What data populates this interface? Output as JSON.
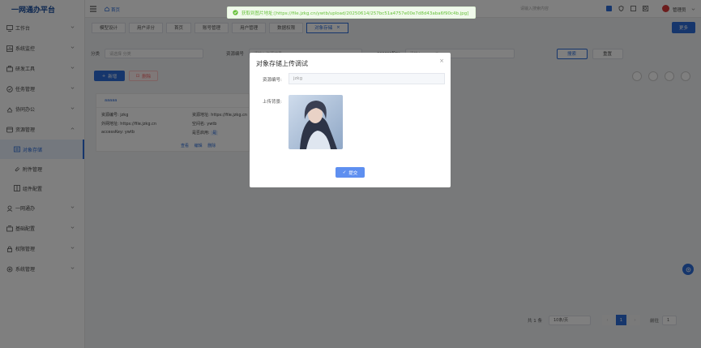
{
  "app": {
    "title": "一网通办平台"
  },
  "sidebar": {
    "items": [
      {
        "label": "工作台",
        "icon": "monitor-icon"
      },
      {
        "label": "系统监控",
        "icon": "chart-icon"
      },
      {
        "label": "研发工具",
        "icon": "tool-icon"
      },
      {
        "label": "任务管理",
        "icon": "task-icon"
      },
      {
        "label": "协同办公",
        "icon": "cowork-icon"
      },
      {
        "label": "资源管理",
        "icon": "resource-icon"
      }
    ],
    "sub_items": [
      {
        "label": "对象存储",
        "icon": "storage-icon"
      },
      {
        "label": "附件管理",
        "icon": "attachment-icon"
      },
      {
        "label": "组件配置",
        "icon": "config-icon"
      }
    ],
    "more_items": [
      {
        "label": "一网通办",
        "icon": "service-icon"
      },
      {
        "label": "基础配置",
        "icon": "base-icon"
      },
      {
        "label": "权限管理",
        "icon": "permission-icon"
      },
      {
        "label": "系统管理",
        "icon": "system-icon"
      }
    ]
  },
  "topbar": {
    "home": "首页",
    "search_placeholder": "请输入搜索内容",
    "username": "管理员"
  },
  "tabs": [
    "模型设计",
    "用户评分",
    "首页",
    "账号管理",
    "用户管理",
    "数据权限",
    "对象存储"
  ],
  "more_button": "更多",
  "filter": {
    "type_label": "分类",
    "type_placeholder": "请选择 分类",
    "code_label": "资源编号",
    "code_placeholder": "请输入资源编号",
    "key_label": "accessKey",
    "key_placeholder": "请输入accessKey",
    "search": "搜索",
    "reset": "重置"
  },
  "actions": {
    "add": "新增",
    "delete": "删除"
  },
  "card": {
    "header": "aaaaa",
    "fields": [
      {
        "k": "资源编号:",
        "v": "jzkg"
      },
      {
        "k": "资源地址:",
        "v": "https://file.jzkg.cn"
      },
      {
        "k": "外网地址:",
        "v": "https://file.jzkg.cn"
      },
      {
        "k": "空间名:",
        "v": "ywtb"
      },
      {
        "k": "accessKey:",
        "v": "ywtb"
      },
      {
        "k": "是否启用:",
        "v": "是"
      }
    ],
    "links": [
      "查看",
      "编辑",
      "删除"
    ]
  },
  "toast": {
    "text": "获取到图片地址:[https://file.jzkg.cn/ywtb/upload/20250614/257bc51a4757e00e7d8d43aba6f90c4b.jpg]"
  },
  "modal": {
    "title": "对象存储上传调试",
    "code_label": "资源编号:",
    "code_value": "jzkg",
    "bg_label": "上传背景:",
    "submit": "提交"
  },
  "pager": {
    "total": "共 1 条",
    "size": "10条/页",
    "page": "1",
    "goto": "前往",
    "goto_value": "1"
  },
  "colors": {
    "primary": "#2d6dd8",
    "success": "#67c23a",
    "danger": "#f56c6c"
  }
}
